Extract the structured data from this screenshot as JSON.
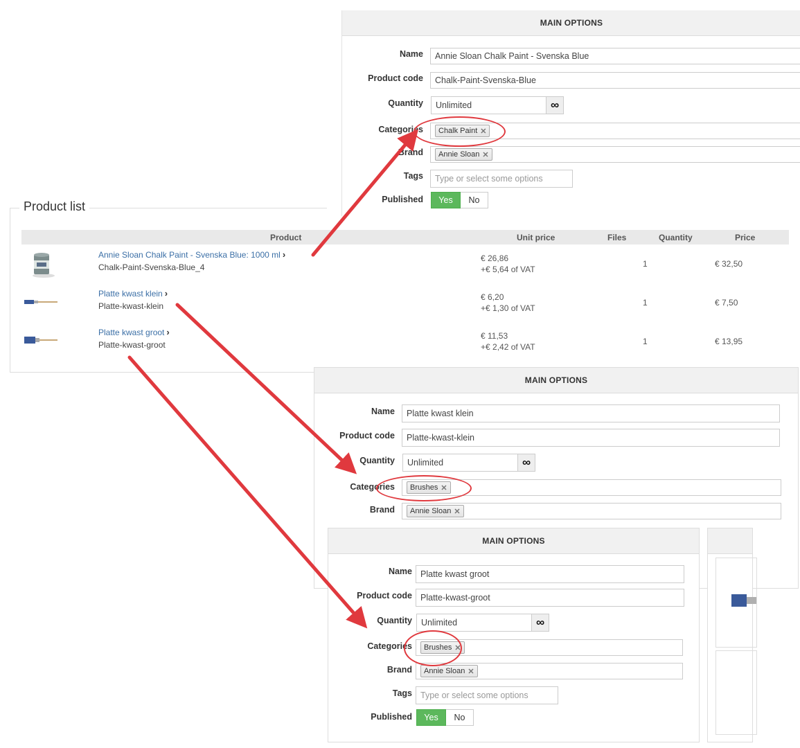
{
  "panel1": {
    "title": "MAIN OPTIONS",
    "name_label": "Name",
    "name_value": "Annie Sloan Chalk Paint - Svenska Blue",
    "code_label": "Product code",
    "code_value": "Chalk-Paint-Svenska-Blue",
    "qty_label": "Quantity",
    "qty_value": "Unlimited",
    "qty_symbol": "∞",
    "cat_label": "Categories",
    "cat_chip": "Chalk Paint",
    "brand_label": "Brand",
    "brand_chip": "Annie Sloan",
    "tags_label": "Tags",
    "tags_placeholder": "Type or select some options",
    "pub_label": "Published",
    "pub_yes": "Yes",
    "pub_no": "No"
  },
  "panel2": {
    "title": "MAIN OPTIONS",
    "name_label": "Name",
    "name_value": "Platte kwast klein",
    "code_label": "Product code",
    "code_value": "Platte-kwast-klein",
    "qty_label": "Quantity",
    "qty_value": "Unlimited",
    "qty_symbol": "∞",
    "cat_label": "Categories",
    "cat_chip": "Brushes",
    "brand_label": "Brand",
    "brand_chip": "Annie Sloan"
  },
  "panel3": {
    "title": "MAIN OPTIONS",
    "name_label": "Name",
    "name_value": "Platte kwast groot",
    "code_label": "Product code",
    "code_value": "Platte-kwast-groot",
    "qty_label": "Quantity",
    "qty_value": "Unlimited",
    "qty_symbol": "∞",
    "cat_label": "Categories",
    "cat_chip": "Brushes",
    "brand_label": "Brand",
    "brand_chip": "Annie Sloan",
    "tags_label": "Tags",
    "tags_placeholder": "Type or select some options",
    "pub_label": "Published",
    "pub_yes": "Yes",
    "pub_no": "No"
  },
  "product_list": {
    "legend": "Product list",
    "headers": {
      "product": "Product",
      "unit_price": "Unit price",
      "files": "Files",
      "quantity": "Quantity",
      "price": "Price"
    },
    "rows": [
      {
        "name": "Annie Sloan Chalk Paint - Svenska Blue: 1000 ml",
        "code": "Chalk-Paint-Svenska-Blue_4",
        "unit": "€ 26,86",
        "vat": "+€ 5,64 of VAT",
        "qty": "1",
        "price": "€ 32,50",
        "thumb": "paint-can-icon"
      },
      {
        "name": "Platte kwast klein",
        "code": "Platte-kwast-klein",
        "unit": "€ 6,20",
        "vat": "+€ 1,30 of VAT",
        "qty": "1",
        "price": "€ 7,50",
        "thumb": "brush-icon"
      },
      {
        "name": "Platte kwast groot",
        "code": "Platte-kwast-groot",
        "unit": "€ 11,53",
        "vat": "+€ 2,42 of VAT",
        "qty": "1",
        "price": "€ 13,95",
        "thumb": "brush-icon"
      }
    ],
    "chevron": "›"
  },
  "colors": {
    "annotation": "#e0393e",
    "link": "#3b6fa6",
    "toggle_on": "#5cb85c"
  }
}
